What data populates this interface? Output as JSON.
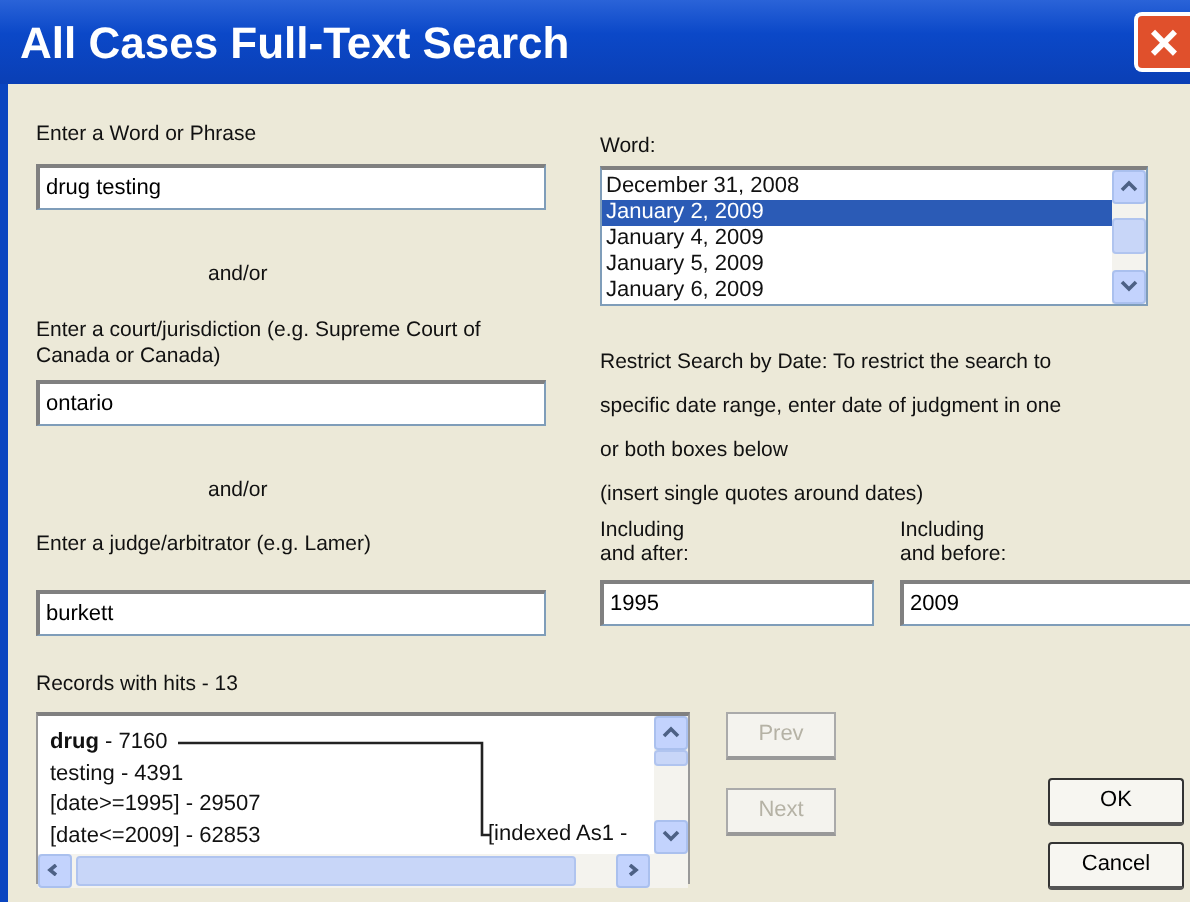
{
  "window": {
    "title": "All Cases Full-Text Search",
    "close_label": "×"
  },
  "left": {
    "word_label": "Enter a Word or Phrase",
    "word_value": "drug testing",
    "andor_1": "and/or",
    "court_label": "Enter a court/jurisdiction  (e.g. Supreme Court of Canada or Canada)",
    "court_value": "ontario",
    "andor_2": "and/or",
    "judge_label": "Enter a judge/arbitrator (e.g. Lamer)",
    "judge_value": "burkett"
  },
  "word_list": {
    "label": "Word:",
    "items": [
      {
        "text": "December 31, 2008",
        "selected": false
      },
      {
        "text": "January 2, 2009",
        "selected": true
      },
      {
        "text": "January 4, 2009",
        "selected": false
      },
      {
        "text": "January 5, 2009",
        "selected": false
      },
      {
        "text": "January 6, 2009",
        "selected": false
      }
    ]
  },
  "date_restrict": {
    "lines": [
      "Restrict Search by Date: To restrict the",
      "search to specific date range, enter date",
      "of judgment in one or both boxes below"
    ],
    "note": "(insert single quotes around dates)",
    "after": {
      "label_1": "Including",
      "label_2": "and after:",
      "value": "1995"
    },
    "before": {
      "label_1": "Including",
      "label_2": "and before:",
      "value": "2009"
    }
  },
  "results": {
    "label": "Records with hits - 13",
    "lines": [
      "**drug** - 7160",
      "testing - 4391",
      "[date>=1995] - 29507",
      "[date<=2009] - 62853"
    ],
    "branch_label": "[indexed As1 -"
  },
  "buttons": [
    {
      "label": "Prev",
      "disabled": true
    },
    {
      "label": "Next",
      "disabled": true
    },
    {
      "label": "OK",
      "disabled": false
    },
    {
      "label": "Cancel",
      "disabled": false
    }
  ]
}
